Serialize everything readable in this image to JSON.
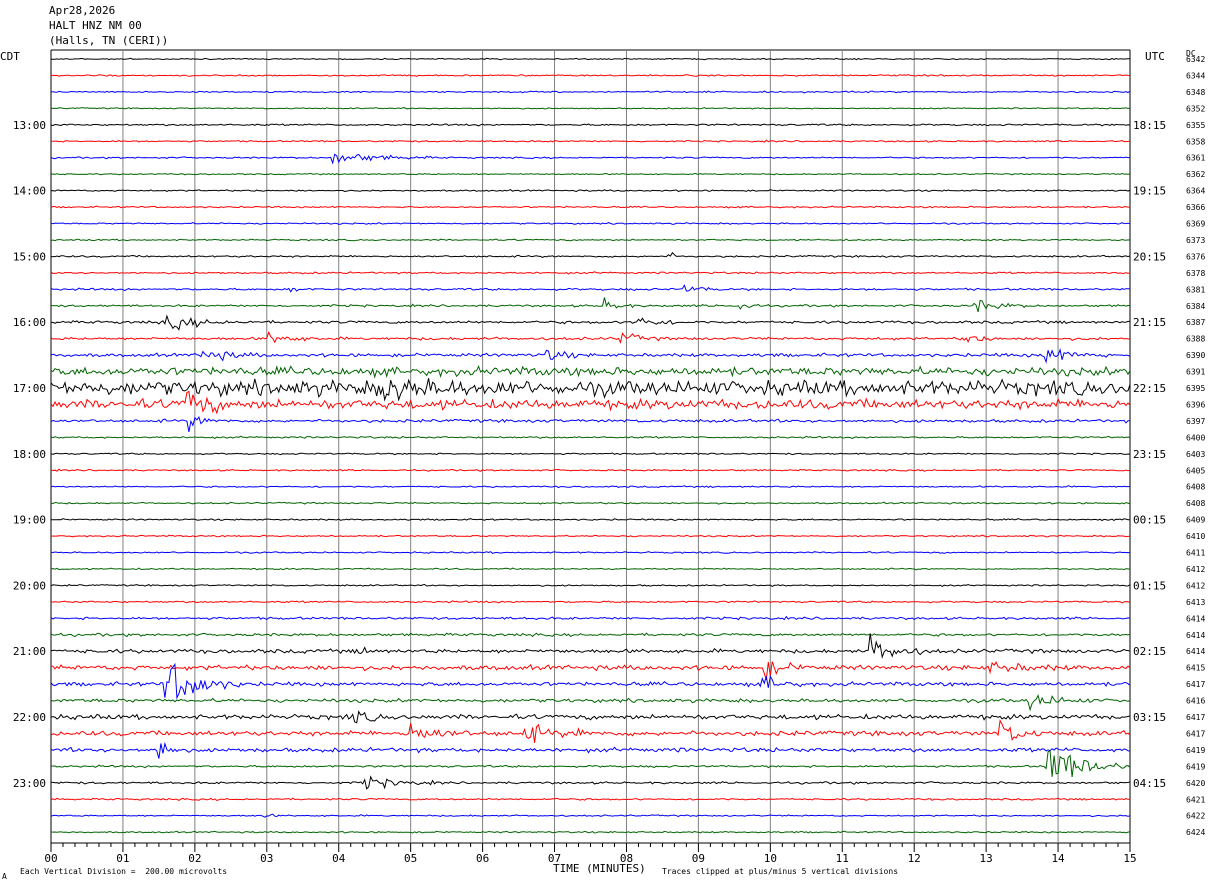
{
  "header": {
    "date": "Apr28,2026",
    "station": "HALT HNZ NM 00",
    "location": "(Halls, TN (CERI))"
  },
  "left_timezone": "CDT",
  "right_timezone": "UTC",
  "dc_label": "DC",
  "footer": {
    "vertical_division": "Each Vertical Division =  200.00 microvolts",
    "clip_note": "Traces clipped at plus/minus 5 vertical divisions",
    "corner_mark": "A"
  },
  "colors": {
    "trace_cycle": [
      "#000000",
      "#ff0000",
      "#0000ff",
      "#006400"
    ],
    "grid": "#808080"
  },
  "chart_data": {
    "type": "seismogram",
    "xlabel": "TIME (MINUTES)",
    "x_range": [
      0,
      15
    ],
    "x_tick_labels": [
      "00",
      "01",
      "02",
      "03",
      "04",
      "05",
      "06",
      "07",
      "08",
      "09",
      "10",
      "11",
      "12",
      "13",
      "14",
      "15"
    ],
    "row_count": 48,
    "left_hour_labels": [
      "13:00",
      "14:00",
      "15:00",
      "16:00",
      "17:00",
      "18:00",
      "19:00",
      "20:00",
      "21:00",
      "22:00",
      "23:00"
    ],
    "right_hour_labels": [
      "18:15",
      "19:15",
      "20:15",
      "21:15",
      "22:15",
      "23:15",
      "00:15",
      "01:15",
      "02:15",
      "03:15",
      "04:15"
    ],
    "hour_label_first_row": 4,
    "rows_per_hour": 4,
    "dc_values": [
      "6342",
      "6344",
      "6348",
      "6352",
      "6355",
      "6358",
      "6361",
      "6362",
      "6364",
      "6366",
      "6369",
      "6373",
      "6376",
      "6378",
      "6381",
      "6384",
      "6387",
      "6388",
      "6390",
      "6391",
      "6395",
      "6396",
      "6397",
      "6400",
      "6403",
      "6405",
      "6408",
      "6408",
      "6409",
      "6410",
      "6411",
      "6412",
      "6412",
      "6413",
      "6414",
      "6414",
      "6414",
      "6415",
      "6417",
      "6416",
      "6417",
      "6417",
      "6419",
      "6419",
      "6420",
      "6421",
      "6422",
      "6424"
    ],
    "row_noise": [
      0.4,
      0.5,
      0.5,
      0.4,
      0.6,
      0.5,
      0.5,
      0.4,
      0.5,
      0.5,
      0.5,
      0.5,
      0.6,
      0.6,
      0.7,
      0.7,
      0.9,
      0.9,
      1.1,
      2.8,
      5.0,
      3.2,
      1.0,
      0.6,
      0.5,
      0.5,
      0.5,
      0.5,
      0.5,
      0.5,
      0.5,
      0.5,
      0.5,
      0.6,
      0.8,
      0.9,
      1.3,
      1.6,
      1.3,
      1.2,
      1.6,
      1.6,
      1.4,
      0.7,
      0.7,
      0.6,
      0.5,
      0.5
    ],
    "events": [
      {
        "row": 6,
        "minute": 3.9,
        "amp": 5,
        "dur": 0.5
      },
      {
        "row": 12,
        "minute": 8.6,
        "amp": 4,
        "dur": 0.05
      },
      {
        "row": 14,
        "minute": 3.3,
        "amp": 3,
        "dur": 0.1
      },
      {
        "row": 14,
        "minute": 8.8,
        "amp": 3,
        "dur": 0.2
      },
      {
        "row": 15,
        "minute": 7.7,
        "amp": 5,
        "dur": 0.15
      },
      {
        "row": 15,
        "minute": 9.6,
        "amp": 5,
        "dur": 0.1
      },
      {
        "row": 15,
        "minute": 12.8,
        "amp": 5,
        "dur": 0.3
      },
      {
        "row": 16,
        "minute": 1.6,
        "amp": 5,
        "dur": 0.4
      },
      {
        "row": 16,
        "minute": 8.1,
        "amp": 4,
        "dur": 0.3
      },
      {
        "row": 17,
        "minute": 3.0,
        "amp": 4,
        "dur": 0.3
      },
      {
        "row": 17,
        "minute": 7.9,
        "amp": 5,
        "dur": 0.2
      },
      {
        "row": 17,
        "minute": 12.7,
        "amp": 4,
        "dur": 0.2
      },
      {
        "row": 18,
        "minute": 2.1,
        "amp": 5,
        "dur": 0.3
      },
      {
        "row": 18,
        "minute": 6.9,
        "amp": 4,
        "dur": 0.2
      },
      {
        "row": 18,
        "minute": 13.8,
        "amp": 7,
        "dur": 0.3
      },
      {
        "row": 20,
        "minute": 4.6,
        "amp": 8,
        "dur": 0.4
      },
      {
        "row": 21,
        "minute": 1.9,
        "amp": 12,
        "dur": 0.2
      },
      {
        "row": 22,
        "minute": 1.9,
        "amp": 6,
        "dur": 0.2
      },
      {
        "row": 36,
        "minute": 4.3,
        "amp": 5,
        "dur": 0.1
      },
      {
        "row": 36,
        "minute": 11.4,
        "amp": 10,
        "dur": 0.3
      },
      {
        "row": 37,
        "minute": 9.9,
        "amp": 8,
        "dur": 0.2
      },
      {
        "row": 37,
        "minute": 13.0,
        "amp": 4,
        "dur": 0.4
      },
      {
        "row": 38,
        "minute": 1.6,
        "amp": 20,
        "dur": 0.35
      },
      {
        "row": 38,
        "minute": 9.9,
        "amp": 6,
        "dur": 0.2
      },
      {
        "row": 39,
        "minute": 13.6,
        "amp": 6,
        "dur": 0.3
      },
      {
        "row": 40,
        "minute": 4.2,
        "amp": 5,
        "dur": 0.2
      },
      {
        "row": 41,
        "minute": 5.0,
        "amp": 8,
        "dur": 0.3
      },
      {
        "row": 41,
        "minute": 6.6,
        "amp": 8,
        "dur": 0.2
      },
      {
        "row": 41,
        "minute": 7.3,
        "amp": 6,
        "dur": 0.1
      },
      {
        "row": 41,
        "minute": 13.2,
        "amp": 10,
        "dur": 0.2
      },
      {
        "row": 42,
        "minute": 1.5,
        "amp": 15,
        "dur": 0.1
      },
      {
        "row": 43,
        "minute": 13.85,
        "amp": 18,
        "dur": 0.4
      },
      {
        "row": 44,
        "minute": 4.3,
        "amp": 5,
        "dur": 0.4
      },
      {
        "row": 46,
        "minute": 2.9,
        "amp": 3,
        "dur": 0.1
      }
    ]
  }
}
